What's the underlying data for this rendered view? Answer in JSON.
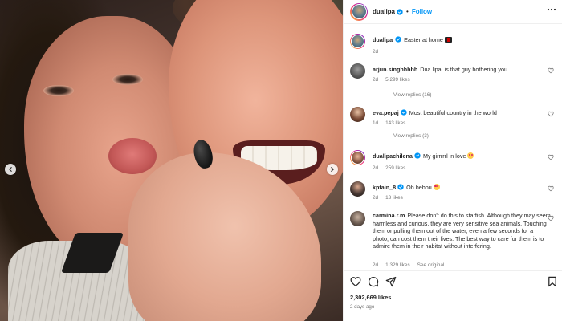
{
  "post": {
    "username": "dualipa",
    "follow_label": "Follow",
    "separator": "•"
  },
  "caption": {
    "username": "dualipa",
    "text": "Easter at home",
    "emoji": "flag-emoji",
    "time": "2d"
  },
  "comments": [
    {
      "username": "arjun.singhhhhh",
      "text": "Dua lipa, is that guy bothering you",
      "time": "2d",
      "likes": "5,299 likes",
      "replies": "View replies (16)"
    },
    {
      "username": "eva.pepaj",
      "verified": true,
      "text": "Most beautiful country in the world",
      "time": "1d",
      "likes": "143 likes",
      "replies": "View replies (3)"
    },
    {
      "username": "dualipachilena",
      "verified": true,
      "text": "My girrrrrl in love",
      "emoji": "heart-eyes-emoji",
      "time": "2d",
      "likes": "259 likes"
    },
    {
      "username": "kptain_8",
      "verified": true,
      "text": "Oh bebou",
      "emoji": "heart-eyes-emoji",
      "time": "2d",
      "likes": "13 likes"
    },
    {
      "username": "carmina.r.m",
      "text": "Please don't do this to starfish. Although they may seem harmless and curious, they are very sensitive sea animals. Touching them or pulling them out of the water, even a few seconds for a photo, can cost them their lives. The best way to care for them is to admire them in their habitat without interfering.",
      "time": "2d",
      "likes": "1,329 likes",
      "see_original": "See original"
    }
  ],
  "footer": {
    "likes": "2,302,669 likes",
    "timestamp": "2 days ago"
  },
  "icons": {
    "verified": "verified-badge-icon",
    "more": "more-options-icon",
    "like": "heart-icon",
    "comment": "comment-icon",
    "share": "share-icon",
    "save": "bookmark-icon",
    "prev": "chevron-left-icon",
    "next": "chevron-right-icon"
  },
  "colors": {
    "accent": "#0095f6",
    "text": "#262626",
    "secondary": "#737373",
    "border": "#efefef"
  }
}
